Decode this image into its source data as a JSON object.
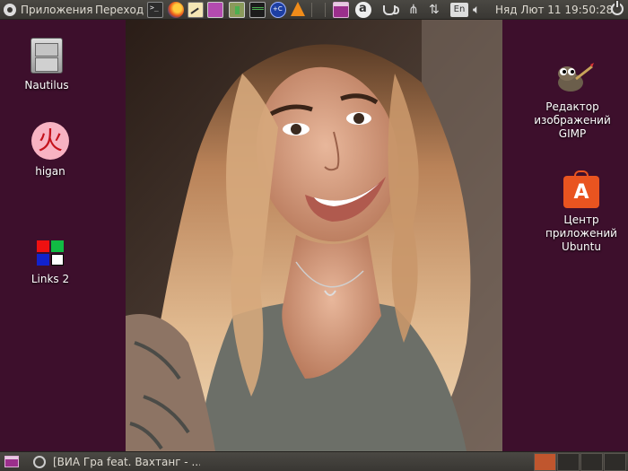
{
  "top_panel": {
    "applications_menu": "Приложения",
    "places_menu": "Переход",
    "keyboard_layout": "En",
    "clock": "Няд Лют 11 19:50:28"
  },
  "desktop": {
    "icons": [
      {
        "label": "Nautilus",
        "icon": "file-cabinet-icon"
      },
      {
        "label": "higan",
        "icon": "higan-fire-icon"
      },
      {
        "label": "Links 2",
        "icon": "links-icon"
      },
      {
        "label": "Редактор изображений GIMP",
        "icon": "gimp-icon"
      },
      {
        "label": "Центр приложений Ubuntu",
        "icon": "shopping-bag-icon"
      }
    ],
    "wallpaper_color": "#3d0f2c"
  },
  "bottom_panel": {
    "task_button_label": "[ВИА Гра feat. Вахтанг - ...",
    "active_workspace_color": "#c0562e"
  }
}
